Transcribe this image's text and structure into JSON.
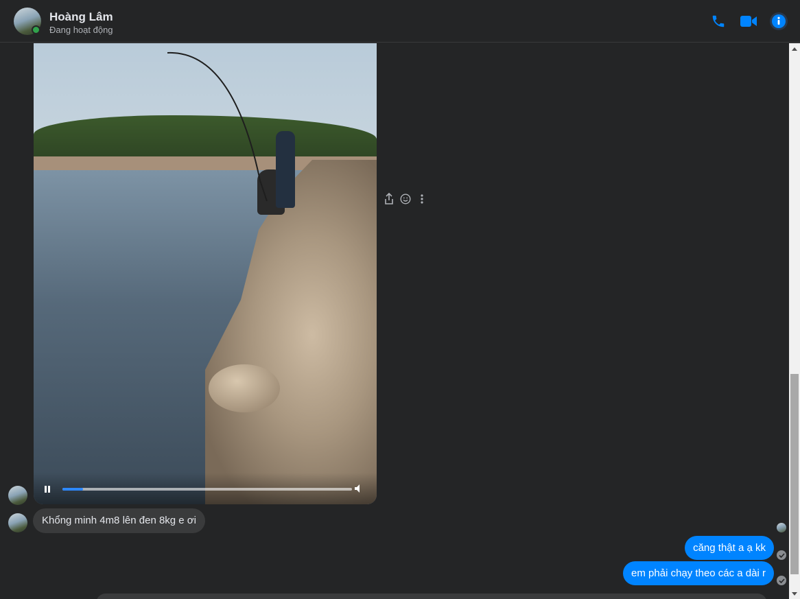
{
  "header": {
    "contact_name": "Hoàng Lâm",
    "status": "Đang hoạt động",
    "actions": [
      "phone-icon",
      "video-camera-icon",
      "info-icon"
    ],
    "accent_color": "#0084ff"
  },
  "video": {
    "progress": 0.07
  },
  "messages": {
    "incoming": [
      {
        "text": "Khổng minh 4m8 lên đen 8kg e ơi"
      }
    ],
    "outgoing": [
      {
        "text": "căng thật a ạ kk"
      },
      {
        "text": "em phải chạy theo các a dài r"
      }
    ]
  }
}
